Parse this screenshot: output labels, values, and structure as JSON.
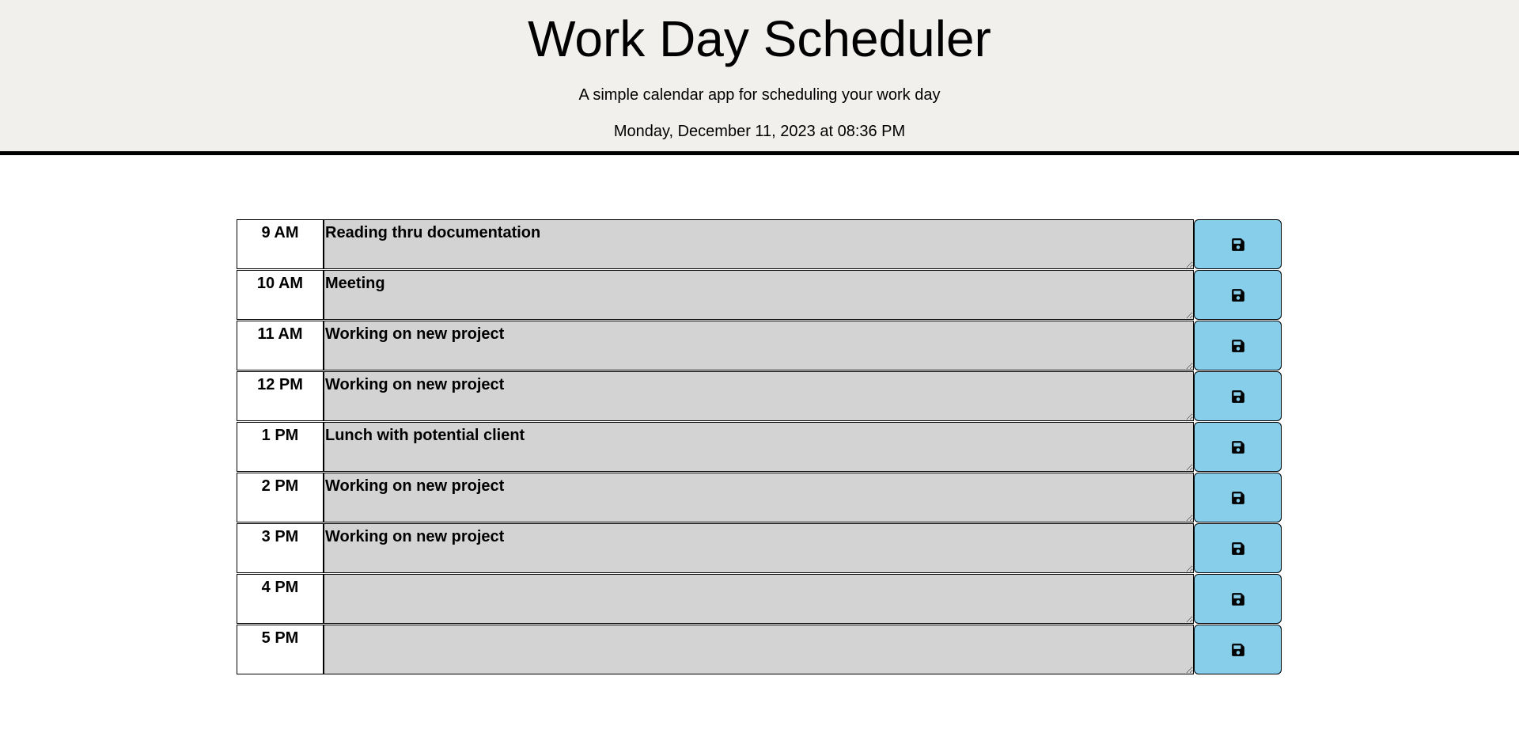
{
  "header": {
    "title": "Work Day Scheduler",
    "subtitle": "A simple calendar app for scheduling your work day",
    "current_day": "Monday, December 11, 2023 at 08:36 PM"
  },
  "blocks": [
    {
      "hour": "9 AM",
      "text": "Reading thru documentation"
    },
    {
      "hour": "10 AM",
      "text": "Meeting"
    },
    {
      "hour": "11 AM",
      "text": "Working on new project"
    },
    {
      "hour": "12 PM",
      "text": "Working on new project"
    },
    {
      "hour": "1 PM",
      "text": "Lunch with potential client"
    },
    {
      "hour": "2 PM",
      "text": "Working on new project"
    },
    {
      "hour": "3 PM",
      "text": "Working on new project"
    },
    {
      "hour": "4 PM",
      "text": ""
    },
    {
      "hour": "5 PM",
      "text": ""
    }
  ],
  "icons": {
    "save": "floppy-disk-icon"
  },
  "colors": {
    "header_bg": "#f1f0ed",
    "past_block": "#d3d3d3",
    "save_button": "#87ceeb"
  }
}
